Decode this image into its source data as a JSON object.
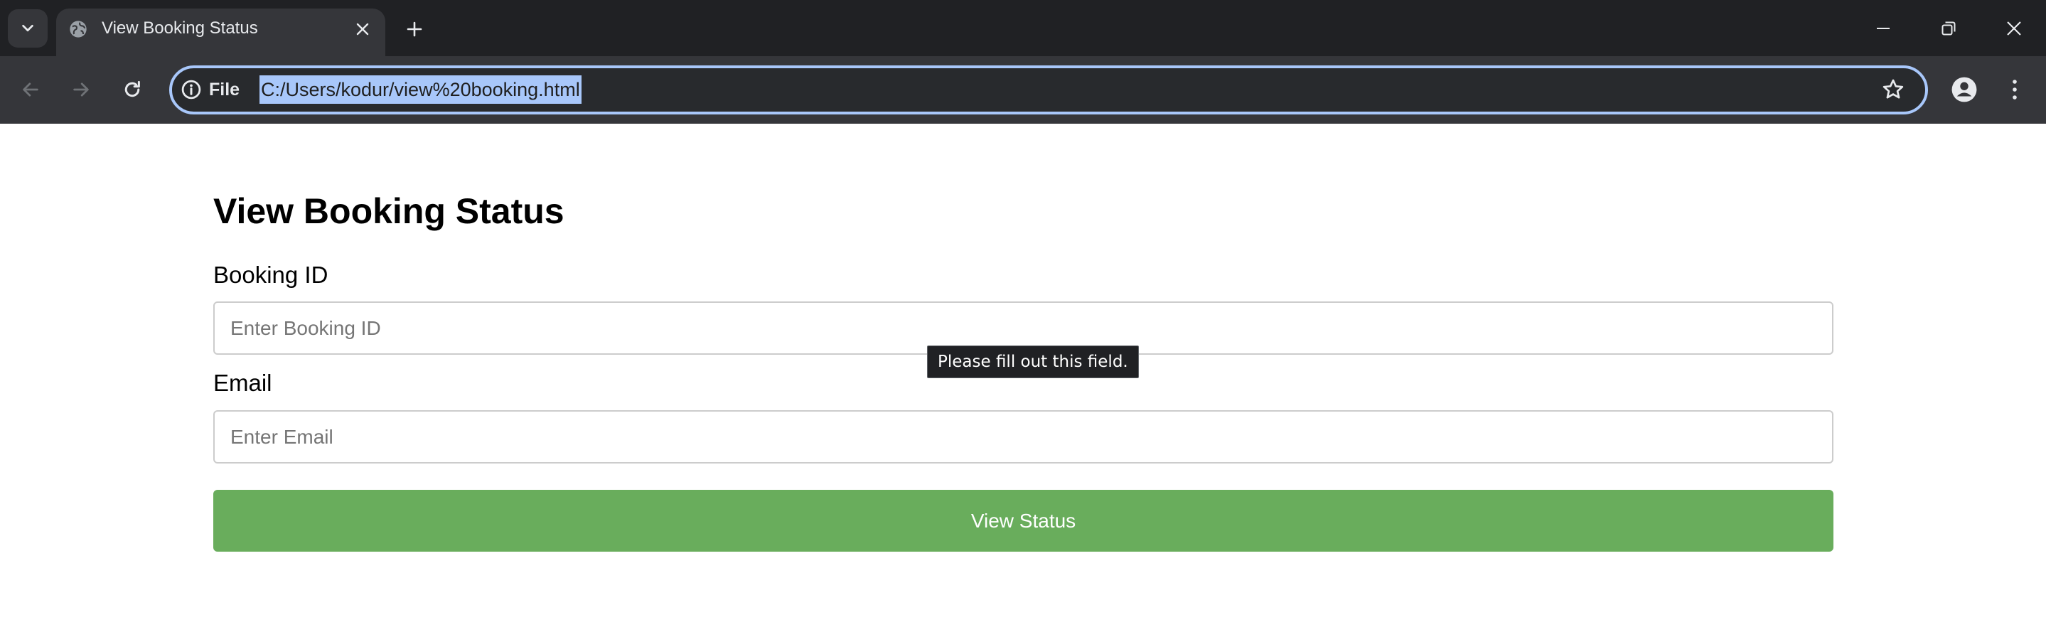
{
  "browser": {
    "tab": {
      "title": "View Booking Status"
    },
    "address_bar": {
      "site_info_label": "File",
      "url": "C:/Users/kodur/view%20booking.html"
    },
    "icons": {
      "tab_search": "chevron-down-icon",
      "favicon": "globe-icon",
      "tab_close": "close-icon",
      "new_tab": "plus-icon",
      "back": "arrow-left-icon",
      "forward": "arrow-right-icon",
      "reload": "reload-icon",
      "site_info": "info-icon",
      "bookmark": "star-icon",
      "profile": "person-icon",
      "menu": "kebab-menu-icon",
      "minimize": "minimize-icon",
      "restore": "restore-icon",
      "close_window": "close-icon"
    }
  },
  "page": {
    "title": "View Booking Status",
    "booking_field": {
      "label": "Booking ID",
      "placeholder": "Enter Booking ID",
      "value": ""
    },
    "email_field": {
      "label": "Email",
      "placeholder": "Enter Email",
      "value": ""
    },
    "submit": {
      "label": "View Status"
    },
    "validation_tooltip": "Please fill out this field."
  },
  "colors": {
    "chrome_dark": "#202124",
    "toolbar": "#35363a",
    "omnibox_focus": "#a8c7fa",
    "submit_button": "#69ad5c",
    "input_border": "#cccccc"
  }
}
